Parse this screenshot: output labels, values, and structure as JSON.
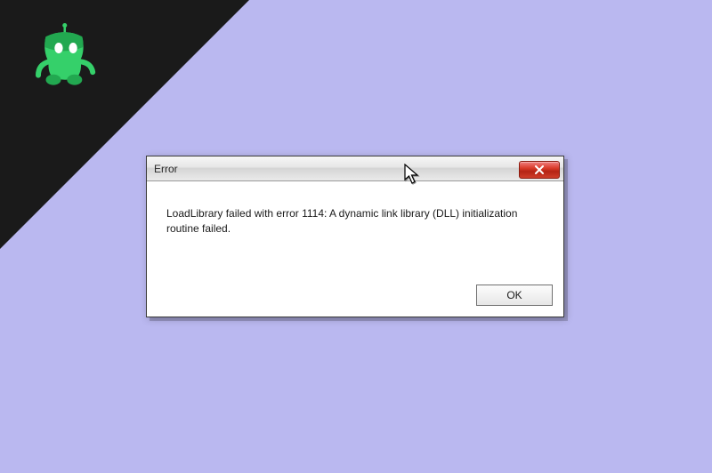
{
  "dialog": {
    "title": "Error",
    "message": "LoadLibrary failed with error 1114: A dynamic link library (DLL) initialization routine failed.",
    "ok_label": "OK"
  },
  "logo": {
    "name": "robot-mascot",
    "bg_color": "#1a1a1a",
    "body_color": "#35d06a",
    "body_shadow": "#22a850",
    "accent_color": "#ffffff"
  }
}
